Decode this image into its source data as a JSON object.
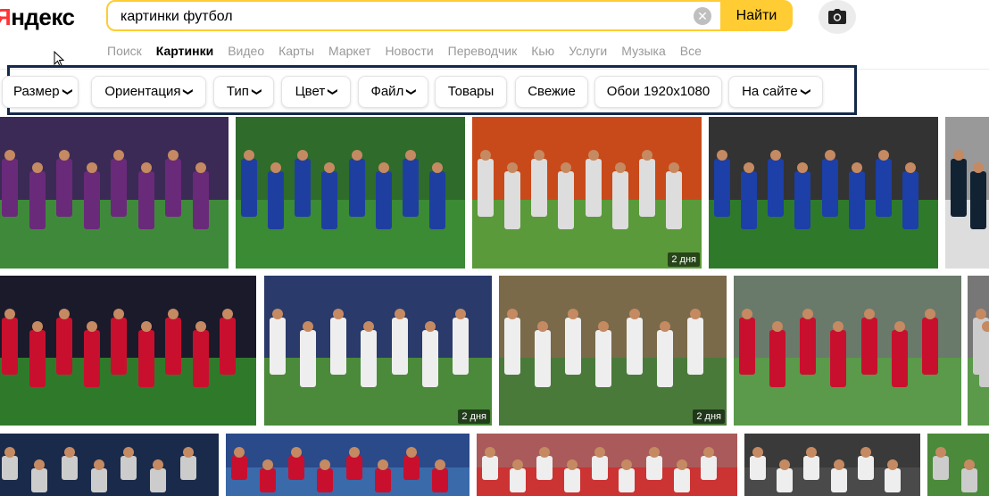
{
  "logo": {
    "accent": "Я",
    "rest": "ндекс"
  },
  "search": {
    "query": "картинки футбол",
    "button": "Найти",
    "clear_glyph": "✕"
  },
  "services": [
    "Поиск",
    "Картинки",
    "Видео",
    "Карты",
    "Маркет",
    "Новости",
    "Переводчик",
    "Кью",
    "Услуги",
    "Музыка",
    "Все"
  ],
  "active_service": "Картинки",
  "filters": [
    "Размер",
    "Ориентация",
    "Тип",
    "Цвет",
    "Файл",
    "Товары",
    "Свежие",
    "Обои 1920x1080",
    "На сайте"
  ],
  "filters_with_dropdown": [
    "Размер",
    "Ориентация",
    "Тип",
    "Цвет",
    "Файл",
    "На сайте"
  ],
  "icons": {
    "camera": "camera-icon",
    "clear": "clear-icon",
    "chevron": "chevron-down-icon",
    "cursor": "mouse-cursor"
  },
  "colors": {
    "brand_yellow": "#ffcc33",
    "logo_red": "#ff3333",
    "frame": "#14294a",
    "cska_blue": "#1c3fa8",
    "cska_red": "#c8102e"
  },
  "results": [
    {
      "age": ""
    },
    {
      "age": ""
    },
    {
      "age": "2 дня"
    },
    {
      "age": ""
    },
    {
      "age": ""
    },
    {
      "age": ""
    },
    {
      "age": "2 дня"
    },
    {
      "age": "2 дня"
    },
    {
      "age": ""
    },
    {
      "age": ""
    },
    {
      "age": ""
    },
    {
      "age": ""
    },
    {
      "age": ""
    },
    {
      "age": ""
    },
    {
      "age": ""
    }
  ]
}
